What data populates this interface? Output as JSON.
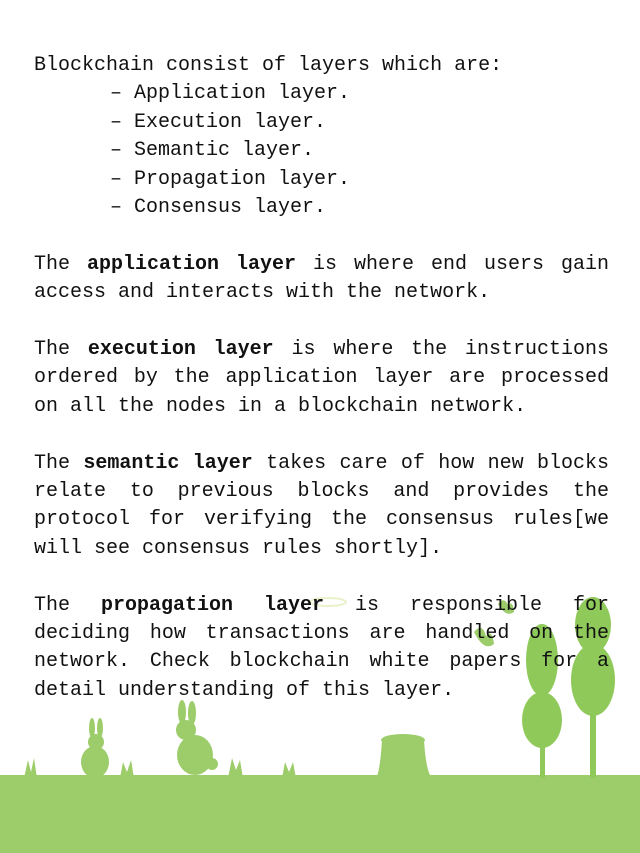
{
  "intro": "Blockchain consist of layers which are:",
  "layers_list": [
    "Application layer.",
    "Execution layer.",
    "Semantic layer.",
    "Propagation layer.",
    "Consensus layer."
  ],
  "paragraphs": [
    {
      "lead": "The ",
      "term": "application layer",
      "body": " is where end users gain access and interacts with the network."
    },
    {
      "lead": "The ",
      "term": "execution layer",
      "body": " is where the instructions ordered by the application layer are processed on all the nodes in a blockchain network."
    },
    {
      "lead": "The ",
      "term": "semantic layer",
      "body": " takes care of how new blocks relate to previous blocks and provides the protocol for verifying the consensus rules[we will see consensus rules shortly]."
    },
    {
      "lead": "The ",
      "term": "propagation layer",
      "body": " is responsible for deciding how transactions are handled on the network. Check blockchain white papers for a detail understanding of this layer."
    }
  ],
  "colors": {
    "text": "#111111",
    "grass": "#9ccd6a",
    "tree": "#8ec95a",
    "background": "#ffffff"
  },
  "icons": [
    "rabbit-icon",
    "tree-icon",
    "tree-stump-icon",
    "bird-icon",
    "grass-tuft-icon"
  ]
}
